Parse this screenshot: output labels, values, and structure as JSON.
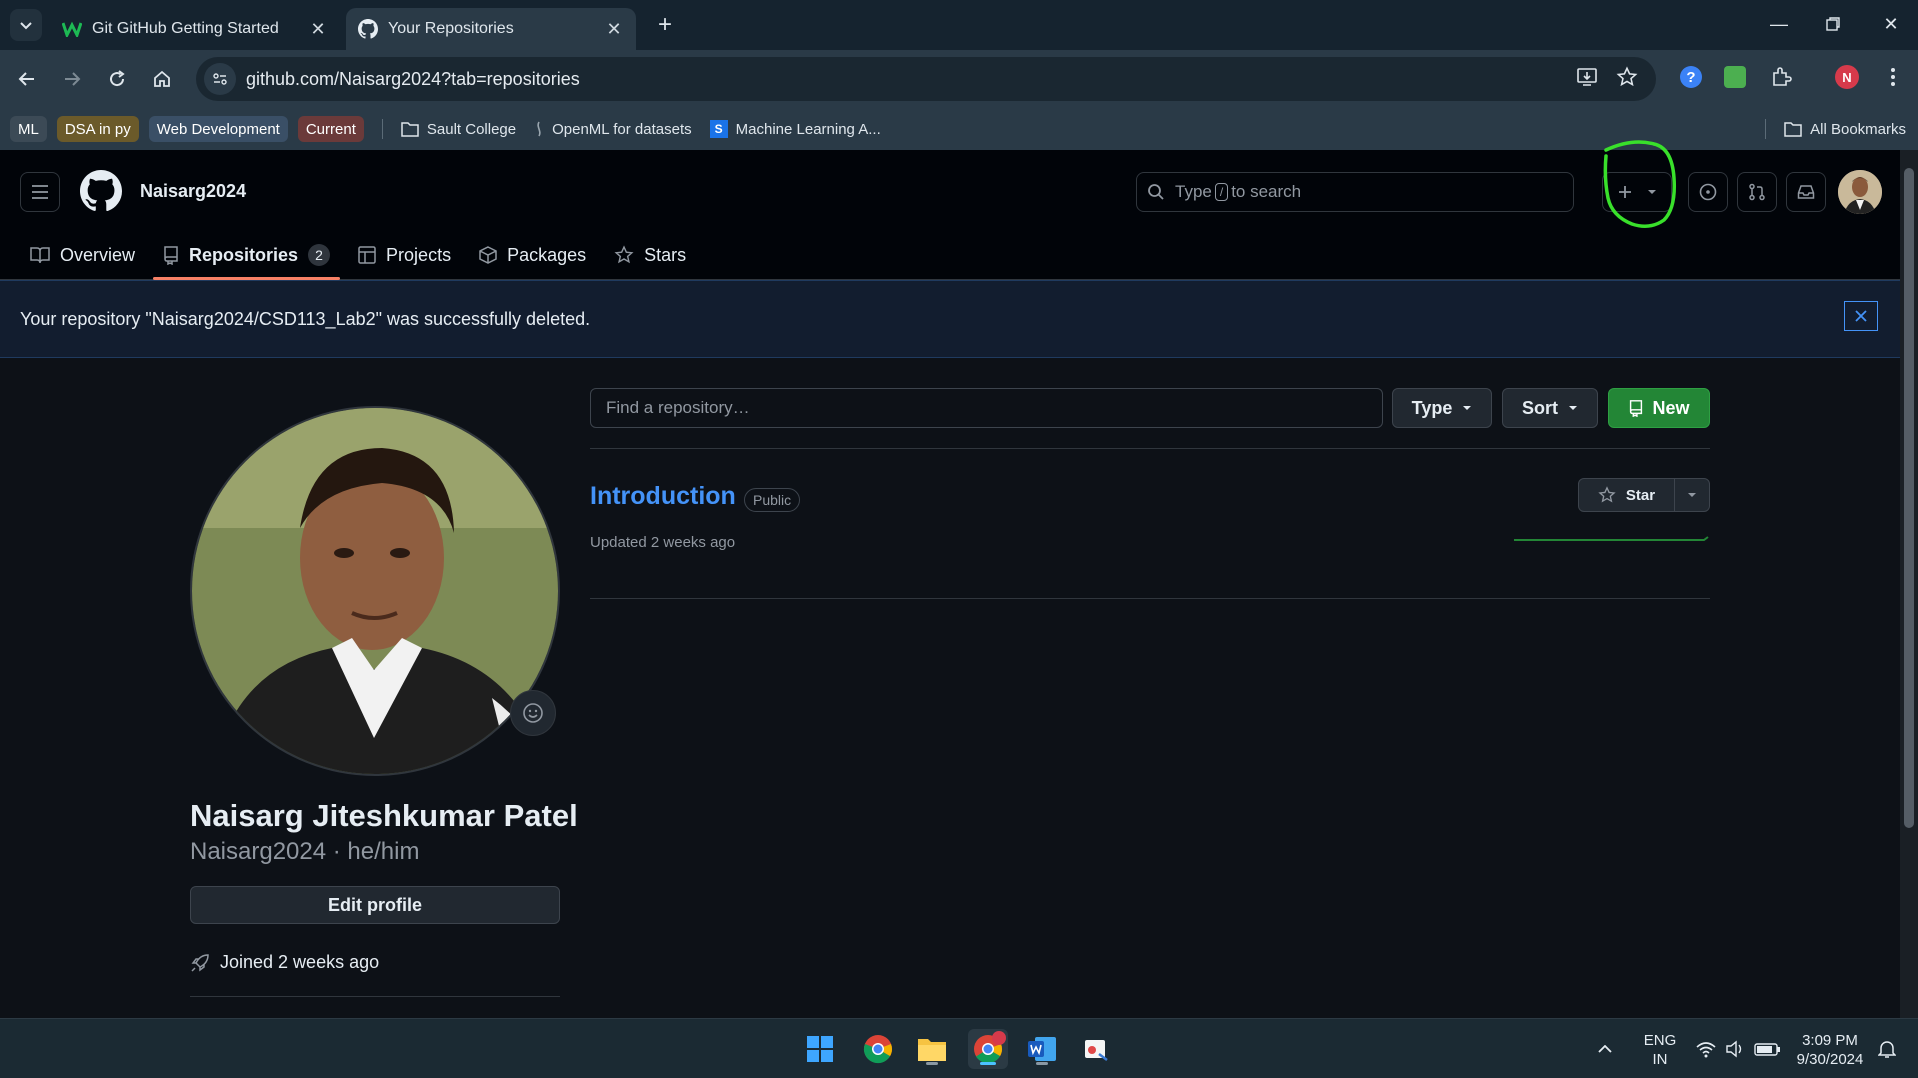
{
  "browser": {
    "tabs": [
      {
        "title": "Git GitHub Getting Started",
        "favicon": "w-icon",
        "active": false
      },
      {
        "title": "Your Repositories",
        "favicon": "github-icon",
        "active": true
      }
    ],
    "url": "github.com/Naisarg2024?tab=repositories",
    "profile_initial": "N",
    "bookmarks": {
      "chips": [
        {
          "label": "ML",
          "color": "#3c4a56"
        },
        {
          "label": "DSA in py",
          "color": "#6b5a2a"
        },
        {
          "label": "Web Development",
          "color": "#3a4f66"
        },
        {
          "label": "Current",
          "color": "#6b3a3a"
        }
      ],
      "items": [
        {
          "label": "Sault College",
          "icon": "folder-icon"
        },
        {
          "label": "OpenML for datasets",
          "icon": "openml-icon"
        },
        {
          "label": "Machine Learning A...",
          "icon": "s-icon"
        }
      ],
      "all_bookmarks": "All Bookmarks"
    }
  },
  "github": {
    "username": "Naisarg2024",
    "search": {
      "pre": "Type",
      "key": "/",
      "post": "to search"
    },
    "tabs": [
      {
        "label": "Overview",
        "icon": "book-icon"
      },
      {
        "label": "Repositories",
        "icon": "repo-icon",
        "count": "2",
        "selected": true
      },
      {
        "label": "Projects",
        "icon": "table-icon"
      },
      {
        "label": "Packages",
        "icon": "package-icon"
      },
      {
        "label": "Stars",
        "icon": "star-icon"
      }
    ],
    "flash": "Your repository \"Naisarg2024/CSD113_Lab2\" was successfully deleted.",
    "profile": {
      "full_name": "Naisarg Jiteshkumar Patel",
      "login_pronouns": "Naisarg2024 · he/him",
      "edit_button": "Edit profile",
      "joined": "Joined 2 weeks ago"
    },
    "repo_list": {
      "find_placeholder": "Find a repository…",
      "type_button": "Type",
      "sort_button": "Sort",
      "new_button": "New",
      "repos": [
        {
          "name": "Introduction",
          "visibility": "Public",
          "updated": "Updated 2 weeks ago",
          "star_label": "Star"
        }
      ]
    },
    "colors": {
      "accent_link": "#4493f8",
      "new_button": "#238636",
      "tab_underline": "#f78166",
      "annotation": "#39e02b"
    }
  },
  "taskbar": {
    "language": "ENG",
    "region": "IN",
    "time": "3:09 PM",
    "date": "9/30/2024"
  }
}
